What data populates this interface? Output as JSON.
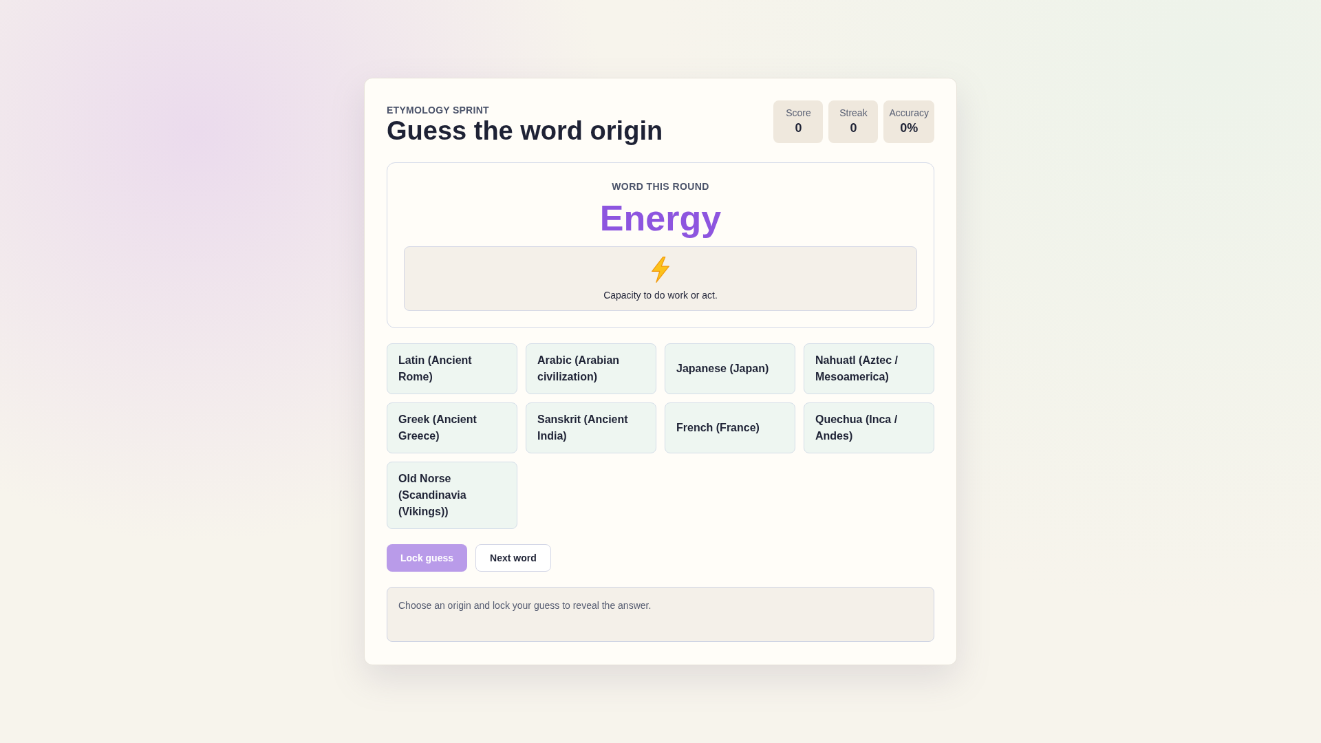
{
  "header": {
    "eyebrow": "ETYMOLOGY SPRINT",
    "title": "Guess the word origin"
  },
  "stats": [
    {
      "label": "Score",
      "value": "0"
    },
    {
      "label": "Streak",
      "value": "0"
    },
    {
      "label": "Accuracy",
      "value": "0%"
    }
  ],
  "word_card": {
    "heading": "WORD THIS ROUND",
    "word": "Energy",
    "hint": "Capacity to do work or act."
  },
  "options": [
    {
      "label": "Latin (Ancient Rome)",
      "selected": false
    },
    {
      "label": "Arabic (Arabian civilization)",
      "selected": false
    },
    {
      "label": "Japanese (Japan)",
      "selected": false
    },
    {
      "label": "Nahuatl (Aztec / Mesoamerica)",
      "selected": false
    },
    {
      "label": "Greek (Ancient Greece)",
      "selected": false
    },
    {
      "label": "Sanskrit (Ancient India)",
      "selected": false
    },
    {
      "label": "French (France)",
      "selected": false
    },
    {
      "label": "Quechua (Inca / Andes)",
      "selected": false
    },
    {
      "label": "Old Norse (Scandinavia (Vikings))",
      "selected": false
    }
  ],
  "buttons": [
    {
      "label": "Lock guess",
      "kind": "primary",
      "disabled": true
    },
    {
      "label": "Next word",
      "kind": "secondary",
      "disabled": false
    }
  ],
  "feedback": {
    "message": "Choose an origin and lock your guess to reveal the answer."
  }
}
